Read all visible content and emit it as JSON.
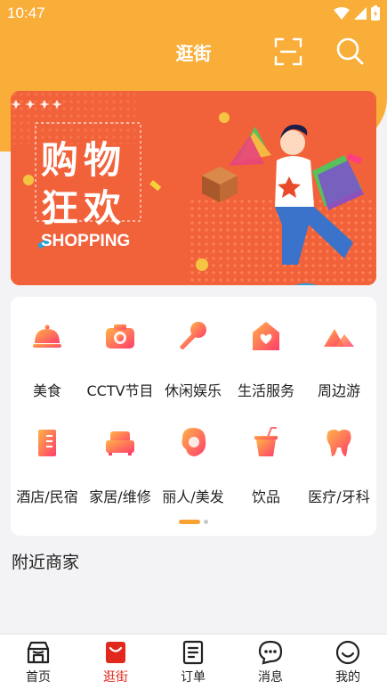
{
  "status_bar": {
    "time": "10:47"
  },
  "header": {
    "title": "逛街"
  },
  "banner": {
    "line1": "购物",
    "line2": "狂欢",
    "subtitle": "SHOPPING"
  },
  "categories": [
    {
      "label": "美食",
      "icon": "food-cloche-icon"
    },
    {
      "label": "CCTV节目",
      "icon": "camera-icon"
    },
    {
      "label": "休闲娱乐",
      "icon": "microphone-icon"
    },
    {
      "label": "生活服务",
      "icon": "home-heart-icon"
    },
    {
      "label": "周边游",
      "icon": "mountain-icon"
    },
    {
      "label": "酒店/民宿",
      "icon": "hotel-icon"
    },
    {
      "label": "家居/维修",
      "icon": "sofa-icon"
    },
    {
      "label": "丽人/美发",
      "icon": "beauty-icon"
    },
    {
      "label": "饮品",
      "icon": "drink-icon"
    },
    {
      "label": "医疗/牙科",
      "icon": "tooth-icon"
    }
  ],
  "nearby": {
    "title": "附近商家"
  },
  "tabbar": [
    {
      "label": "首页",
      "icon": "home-shop-icon",
      "active": false
    },
    {
      "label": "逛街",
      "icon": "shopping-bag-icon",
      "active": true
    },
    {
      "label": "订单",
      "icon": "order-list-icon",
      "active": false
    },
    {
      "label": "消息",
      "icon": "message-icon",
      "active": false
    },
    {
      "label": "我的",
      "icon": "profile-icon",
      "active": false
    }
  ],
  "colors": {
    "primary": "#f9ae39",
    "accent_red": "#e0281c",
    "banner": "#f2623a"
  }
}
